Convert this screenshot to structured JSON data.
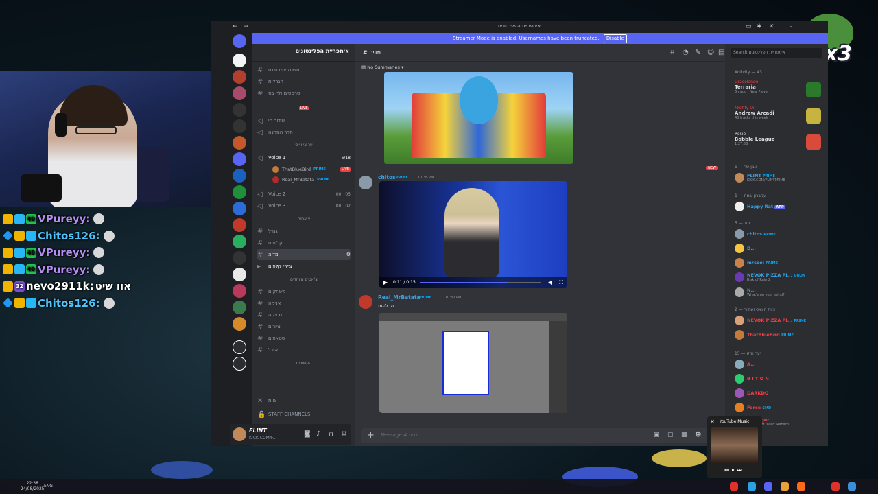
{
  "chat_overlay": [
    {
      "badges": [
        "gold-1",
        "cyan",
        "green-40"
      ],
      "user": "VPureyy:",
      "color": "#b48cf2"
    },
    {
      "badges": [
        "sword",
        "gold-crown",
        "cyan"
      ],
      "user": "Chitos126:",
      "color": "#4fc3f7"
    },
    {
      "badges": [
        "gold-1",
        "cyan",
        "green-40"
      ],
      "user": "VPureyy:",
      "color": "#b48cf2"
    },
    {
      "badges": [
        "gold-1",
        "cyan",
        "green-40"
      ],
      "user": "VPureyy:",
      "color": "#b48cf2"
    },
    {
      "badges": [
        "crown",
        "purple-32"
      ],
      "user": "nevo2911k:",
      "message": "אוו שיט",
      "color": "#ffffff"
    },
    {
      "badges": [
        "sword",
        "gold-crown",
        "cyan"
      ],
      "user": "Chitos126:",
      "color": "#4fc3f7"
    }
  ],
  "badge_labels": {
    "one": "1",
    "forty": "40",
    "thirtytwo": "32"
  },
  "overlay": {
    "multiplier": "x3"
  },
  "window": {
    "title": "אימפריית הפלינטונים",
    "streamer_banner": "Streamer Mode is enabled. Usernames have been truncated.",
    "disable_label": "Disable"
  },
  "server": {
    "name": "אימפריית הפלינטונים"
  },
  "channels": {
    "top": [
      {
        "label": "משחקים-בחינם",
        "y": 0
      },
      {
        "label": "הגרלות",
        "y": 1
      },
      {
        "label": "טרסטים-וליי-בס",
        "y": 2
      }
    ],
    "live_category": "LIVE",
    "live_channels": [
      {
        "label": "שידור חי"
      },
      {
        "label": "חדר המתנה"
      }
    ],
    "voice_category": "ערוצי ווייס",
    "voice1": "Voice 1",
    "voice1_limit": "6/18",
    "voice_users": [
      {
        "name": "ThatBlueBird",
        "badge": "PRIME",
        "live": "LIVE"
      },
      {
        "name": "Real_MrBatata",
        "badge": "PRIME"
      }
    ],
    "voice2": "Voice 2",
    "voice2_count": "00",
    "voice2_limit": "05",
    "voice3": "Voice 3",
    "voice3_count": "00",
    "voice3_limit": "02",
    "chat_category": "צ'אטים",
    "chat_channels": [
      {
        "label": "גנרל"
      },
      {
        "label": "קליפים"
      },
      {
        "label": "מדיה"
      },
      {
        "label": "ציירי-קלפים"
      }
    ],
    "topic_category": "צ'אטים מיוחדים",
    "topic_channels": [
      {
        "label": "משחקים"
      },
      {
        "label": "אנימה"
      },
      {
        "label": "מוזיקה"
      },
      {
        "label": "ציורים"
      },
      {
        "label": "סטאפים"
      },
      {
        "label": "אוכל"
      }
    ],
    "misc_category": "הקשורים",
    "team_label": "צוות",
    "staff_label": "STAFF CHANNELS"
  },
  "user_panel": {
    "name": "FLINT",
    "status": "KICK.COM/F..."
  },
  "chat": {
    "channel": "מדיה",
    "summaries": "No Summaries",
    "messages": [
      {
        "author": "chitos",
        "badge": "PRIME",
        "time": "10:36 PM"
      },
      {
        "author": "Real_MrBatata",
        "badge": "PRIME",
        "time": "10:37 PM",
        "text": "הדלפות"
      }
    ],
    "new_label": "NEW",
    "video_time": "0:11 / 0:15",
    "video_progress": 0.73,
    "composer_placeholder": "Message # מדיה"
  },
  "members": {
    "search_placeholder": "Search אימפריית הפלינטונים",
    "activity_header": "Activity — 43",
    "activities": [
      {
        "user": "Dracolando",
        "game": "Terraria",
        "meta": "6h ago · New Player",
        "icon_color": "#2b7a2b"
      },
      {
        "user": "Mighty Oi",
        "game": "Andrew Arcadi",
        "meta": "43 tracks this week",
        "icon_color": "#c7b440"
      },
      {
        "user": "Rosie",
        "game": "Bobble League",
        "meta": "1:27:53",
        "icon_color": "#d84a3a"
      }
    ],
    "groups": [
      {
        "header": "אבן שר — 1",
        "members": [
          {
            "name": "FLINT",
            "badge": "PRIME",
            "sub": "KICK.COM/FLINTPRIME",
            "color": "#3ba0e0"
          }
        ]
      },
      {
        "header": "עקברון שמח — 1",
        "members": [
          {
            "name": "Happy Rat",
            "badge": "APP",
            "sub": "",
            "color": "#3ba0e0"
          }
        ]
      },
      {
        "header": "מוד — 5",
        "members": [
          {
            "name": "chitos",
            "badge": "PRIME",
            "sub": "",
            "color": "#3ba0e0"
          },
          {
            "name": "D...",
            "badge": "",
            "sub": "",
            "color": "#3ba0e0"
          },
          {
            "name": "mrcool",
            "badge": "PRIME",
            "sub": "",
            "color": "#3ba0e0"
          },
          {
            "name": "NEVOK PIZZA PI...",
            "badge": "GOON",
            "sub": "Risk of Rain 2",
            "color": "#3ba0e0"
          },
          {
            "name": "N...",
            "badge": "",
            "sub": "What's on your mind?",
            "color": "#3ba0e0"
          }
        ]
      },
      {
        "header": "צוות הצאט ושידור — 2",
        "members": [
          {
            "name": "NEVOK PIZZA PI...",
            "badge": "PRIME",
            "sub": "",
            "color": "#f23f43"
          },
          {
            "name": "ThatBlueBird",
            "badge": "PRIME",
            "sub": "",
            "color": "#f23f43"
          }
        ]
      },
      {
        "header": "יער חזק — 15",
        "members": [
          {
            "name": "A...",
            "badge": "",
            "sub": "",
            "color": "#f23f43"
          },
          {
            "name": "B I T O N",
            "badge": "",
            "sub": "",
            "color": "#f23f43"
          },
          {
            "name": "DARKDO",
            "badge": "",
            "sub": "",
            "color": "#f23f43"
          },
          {
            "name": "Force",
            "badge": "SMD",
            "sub": "",
            "color": "#f23f43"
          },
          {
            "name": "...Burger",
            "badge": "",
            "sub": "Binding of Isaac: Rebirth",
            "color": "#f23f43"
          }
        ]
      }
    ]
  },
  "youtube_mini": {
    "title": "YouTube Music"
  },
  "taskbar": {
    "time": "22:38",
    "date": "24/08/2025",
    "lang": "ENG"
  }
}
